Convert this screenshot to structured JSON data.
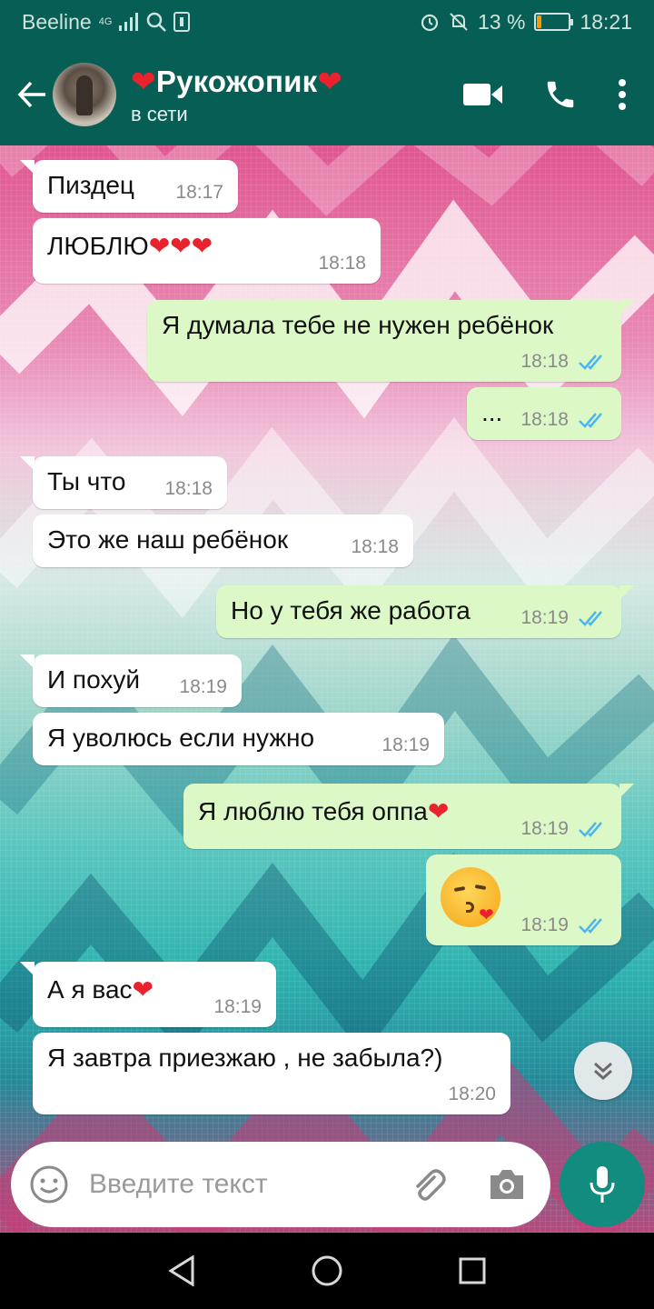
{
  "status_bar": {
    "carrier": "Beeline",
    "network": "4G",
    "battery_percent": "13 %",
    "battery_level": 0.13,
    "time": "18:21",
    "accent_color": "#075e54"
  },
  "header": {
    "contact_name": "❤️Рукожопик❤️",
    "presence": "в сети",
    "icons": [
      "back-arrow-icon",
      "video-call-icon",
      "phone-icon",
      "more-vert-icon"
    ]
  },
  "messages": [
    {
      "dir": "in",
      "text": "Пиздец",
      "time": "18:17"
    },
    {
      "dir": "in",
      "text": "ЛЮБЛЮ❤️❤️❤️",
      "time": "18:18"
    },
    {
      "dir": "out",
      "text": "Я думала тебе не нужен ребёнок",
      "time": "18:18",
      "status": "read"
    },
    {
      "dir": "out",
      "text": "...",
      "time": "18:18",
      "status": "read"
    },
    {
      "dir": "in",
      "text": "Ты что",
      "time": "18:18"
    },
    {
      "dir": "in",
      "text": "Это же наш ребёнок",
      "time": "18:18"
    },
    {
      "dir": "out",
      "text": "Но у тебя же работа",
      "time": "18:19",
      "status": "read"
    },
    {
      "dir": "in",
      "text": "И похуй",
      "time": "18:19"
    },
    {
      "dir": "in",
      "text": "Я уволюсь если нужно",
      "time": "18:19"
    },
    {
      "dir": "out",
      "text": "Я люблю тебя оппа❤️",
      "time": "18:19",
      "status": "read"
    },
    {
      "dir": "out",
      "text": "😘",
      "time": "18:19",
      "status": "read"
    },
    {
      "dir": "in",
      "text": "А я вас❤️",
      "time": "18:19"
    },
    {
      "dir": "in",
      "text": "Я завтра приезжаю , не забыла?)",
      "time": "18:20"
    }
  ],
  "composer": {
    "placeholder": "Введите текст",
    "icons": [
      "emoji-icon",
      "attach-icon",
      "camera-icon",
      "mic-icon"
    ]
  },
  "nav": {
    "icons": [
      "nav-back-icon",
      "nav-home-icon",
      "nav-recents-icon"
    ]
  }
}
